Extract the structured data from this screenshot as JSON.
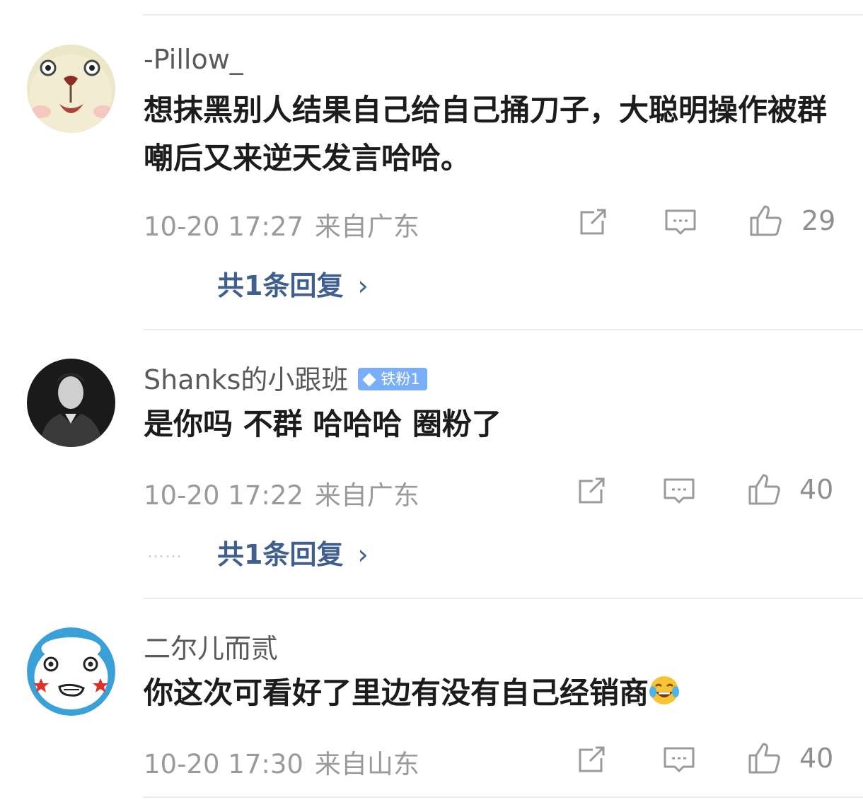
{
  "comments": [
    {
      "username": "-Pillow_",
      "text": "想抹黑别人结果自己给自己捅刀子，大聪明操作被群嘲后又来逆天发言哈哈。",
      "time": "10-20 17:27",
      "location": "来自广东",
      "likes": "29",
      "replies": "共1条回复",
      "avatar": "cartoon-bear-face"
    },
    {
      "username": "Shanks的小跟班",
      "badge": "铁粉1",
      "text": "是你吗 不群 哈哈哈  圈粉了",
      "time": "10-20 17:22",
      "location": "来自广东",
      "likes": "40",
      "replies": "共1条回复",
      "dots": "……",
      "avatar": "person-photo"
    },
    {
      "username": "二尔儿而贰",
      "text": "你这次可看好了里边有没有自己经销商",
      "text_emoji": "laughing-crying-emoji",
      "time": "10-20 17:30",
      "location": "来自山东",
      "likes": "40",
      "avatar": "cartoon-face-blue"
    }
  ],
  "icons": {
    "repost": "edit-share-icon",
    "comment": "comment-bubble-icon",
    "like": "thumbs-up-icon",
    "chevron": "chevron-right-icon"
  },
  "colors": {
    "reply_link": "#3f5f8e",
    "meta": "#9a9a9a",
    "badge": "#7aaef7"
  }
}
